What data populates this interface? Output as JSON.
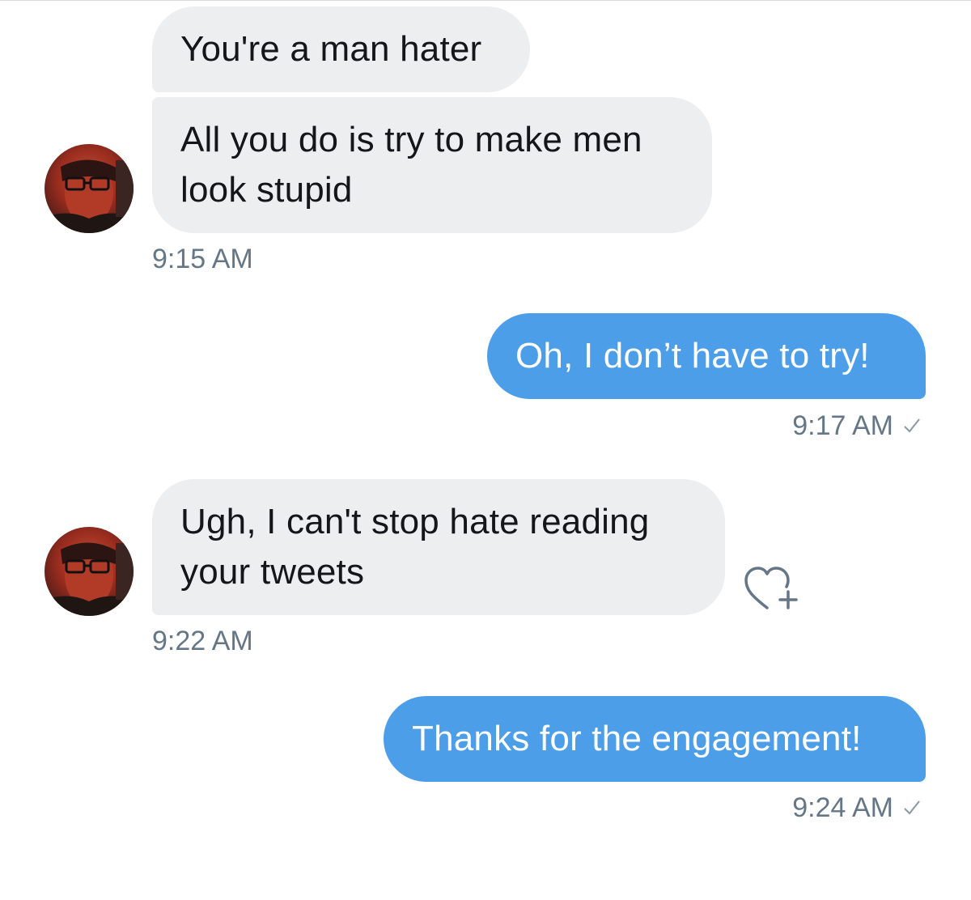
{
  "colors": {
    "incoming_bubble": "#eceef0",
    "outgoing_bubble": "#4c9ee8",
    "timestamp": "#657786",
    "incoming_text": "#14171a",
    "outgoing_text": "#ffffff"
  },
  "messages": [
    {
      "direction": "incoming",
      "text": "You're a man hater"
    },
    {
      "direction": "incoming",
      "text": "All you do is try to make men\nlook stupid",
      "time": "9:15 AM"
    },
    {
      "direction": "outgoing",
      "text": "Oh, I don’t have to try!",
      "time": "9:17 AM",
      "status_icon": "check-icon"
    },
    {
      "direction": "incoming",
      "text": "Ugh, I can't stop hate reading\nyour tweets",
      "time": "9:22 AM",
      "reaction_icon": "heart-plus-icon"
    },
    {
      "direction": "outgoing",
      "text": "Thanks for the engagement!",
      "time": "9:24 AM",
      "status_icon": "check-icon"
    }
  ],
  "sender": {
    "avatar_icon": "avatar"
  }
}
